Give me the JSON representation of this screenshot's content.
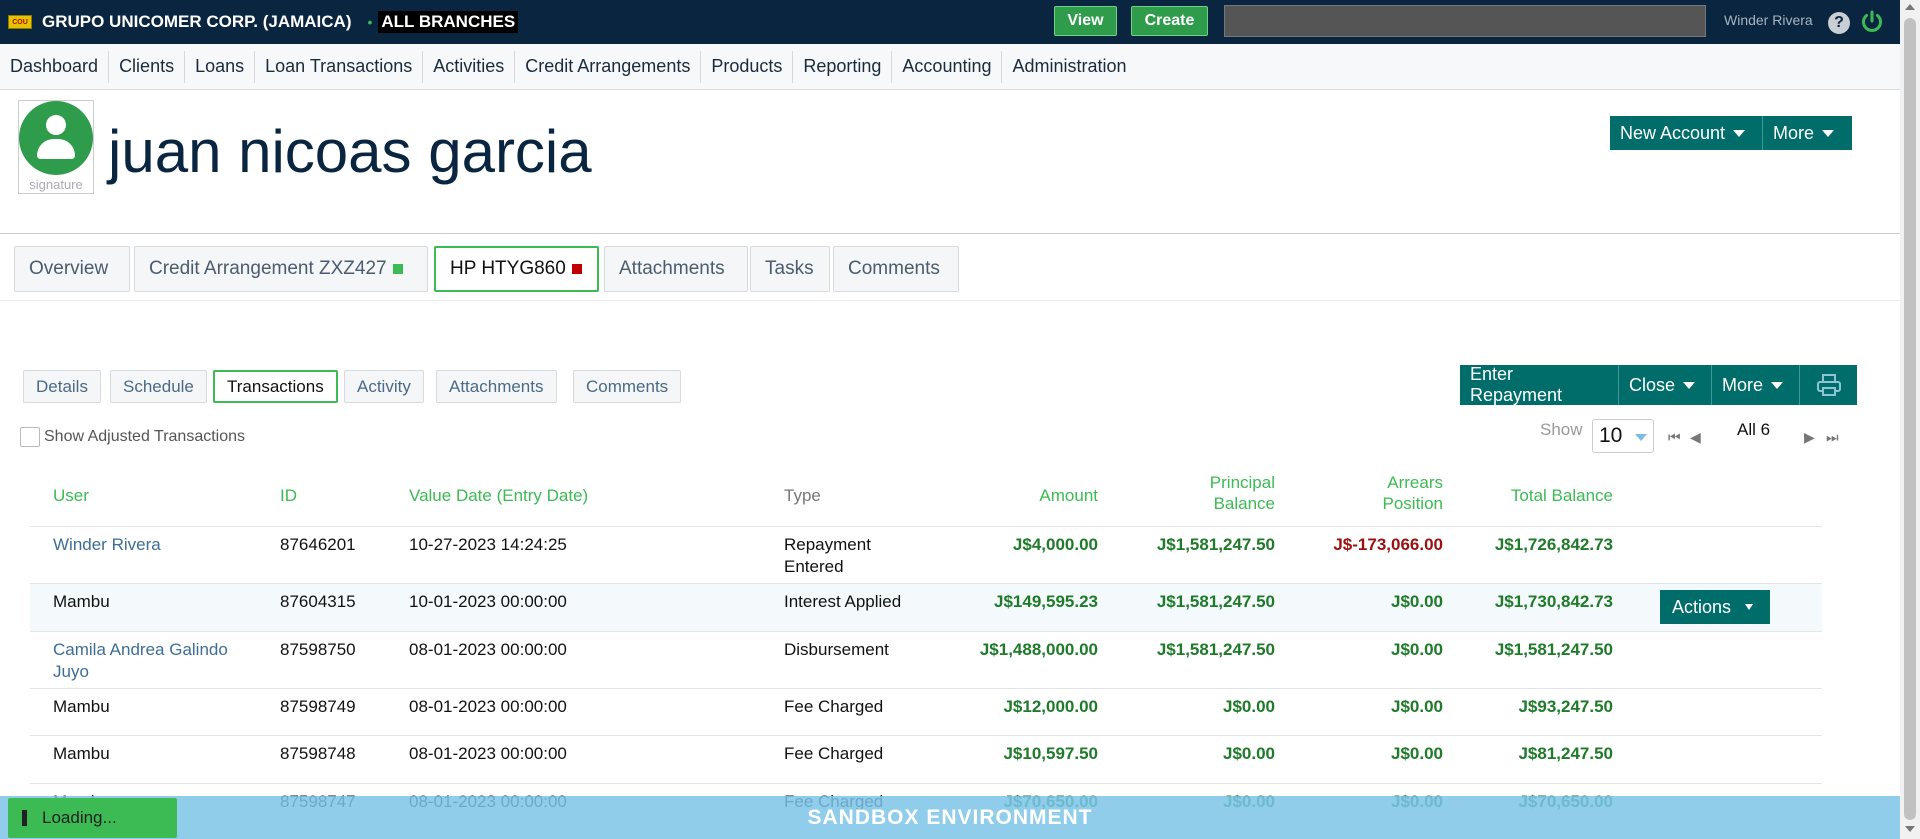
{
  "topbar": {
    "company": "GRUPO UNICOMER CORP. (JAMAICA)",
    "branch_dot": "•",
    "branch": "ALL BRANCHES",
    "view_label": "View",
    "create_label": "Create",
    "search_placeholder": "",
    "user": "Winder Rivera",
    "help": "?"
  },
  "nav": [
    "Dashboard",
    "Clients",
    "Loans",
    "Loan Transactions",
    "Activities",
    "Credit Arrangements",
    "Products",
    "Reporting",
    "Accounting",
    "Administration"
  ],
  "client": {
    "avatar_label": "signature",
    "name": "juan nicoas garcia",
    "new_account_label": "New Account",
    "more_label": "More"
  },
  "tabs": [
    {
      "label": "Overview"
    },
    {
      "label": "Credit Arrangement ZXZ427",
      "status_color": "#3cba54"
    },
    {
      "label": "HP HTYG860",
      "status_color": "#c00000"
    },
    {
      "label": "Attachments"
    },
    {
      "label": "Tasks"
    },
    {
      "label": "Comments"
    }
  ],
  "subtabs": [
    "Details",
    "Schedule",
    "Transactions",
    "Activity",
    "Attachments",
    "Comments"
  ],
  "loan_actions": {
    "enter_repayment": "Enter Repayment",
    "close": "Close",
    "more": "More"
  },
  "filter": {
    "show_adjusted": "Show Adjusted Transactions"
  },
  "pager": {
    "show_label": "Show",
    "page_size": "10",
    "summary": "All 6"
  },
  "table": {
    "headers": {
      "user": "User",
      "id": "ID",
      "value_date": "Value Date (Entry Date)",
      "type": "Type",
      "amount": "Amount",
      "principal_1": "Principal",
      "principal_2": "Balance",
      "arrears_1": "Arrears",
      "arrears_2": "Position",
      "total": "Total Balance"
    },
    "rows": [
      {
        "user": "Winder Rivera",
        "user_2": "",
        "id": "87646201",
        "date": "10-27-2023 14:24:25",
        "type": "Repayment",
        "type_2": "Entered",
        "amount": "J$4,000.00",
        "principal": "J$1,581,247.50",
        "arrears": "J$-173,066.00",
        "total": "J$1,726,842.73"
      },
      {
        "user": "Mambu",
        "user_2": "",
        "id": "87604315",
        "date": "10-01-2023 00:00:00",
        "type": "Interest Applied",
        "type_2": "",
        "amount": "J$149,595.23",
        "principal": "J$1,581,247.50",
        "arrears": "J$0.00",
        "total": "J$1,730,842.73"
      },
      {
        "user": "Camila Andrea Galindo",
        "user_2": "Juyo",
        "id": "87598750",
        "date": "08-01-2023 00:00:00",
        "type": "Disbursement",
        "type_2": "",
        "amount": "J$1,488,000.00",
        "principal": "J$1,581,247.50",
        "arrears": "J$0.00",
        "total": "J$1,581,247.50"
      },
      {
        "user": "Mambu",
        "user_2": "",
        "id": "87598749",
        "date": "08-01-2023 00:00:00",
        "type": "Fee Charged",
        "type_2": "",
        "amount": "J$12,000.00",
        "principal": "J$0.00",
        "arrears": "J$0.00",
        "total": "J$93,247.50"
      },
      {
        "user": "Mambu",
        "user_2": "",
        "id": "87598748",
        "date": "08-01-2023 00:00:00",
        "type": "Fee Charged",
        "type_2": "",
        "amount": "J$10,597.50",
        "principal": "J$0.00",
        "arrears": "J$0.00",
        "total": "J$81,247.50"
      },
      {
        "user": "Mambu",
        "user_2": "",
        "id": "87598747",
        "date": "08-01-2023 00:00:00",
        "type": "Fee Charged",
        "type_2": "",
        "amount": "J$70,650.00",
        "principal": "J$0.00",
        "arrears": "J$0.00",
        "total": "J$70,650.00"
      }
    ],
    "actions_label": "Actions"
  },
  "footer": {
    "sandbox": "SANDBOX ENVIRONMENT",
    "loading": "Loading..."
  },
  "colors": {
    "brand_dark": "#0a2540",
    "accent_green": "#3cba54",
    "teal": "#006d6a",
    "positive_amount": "#1f7a2a",
    "negative_amount": "#9b1111"
  }
}
